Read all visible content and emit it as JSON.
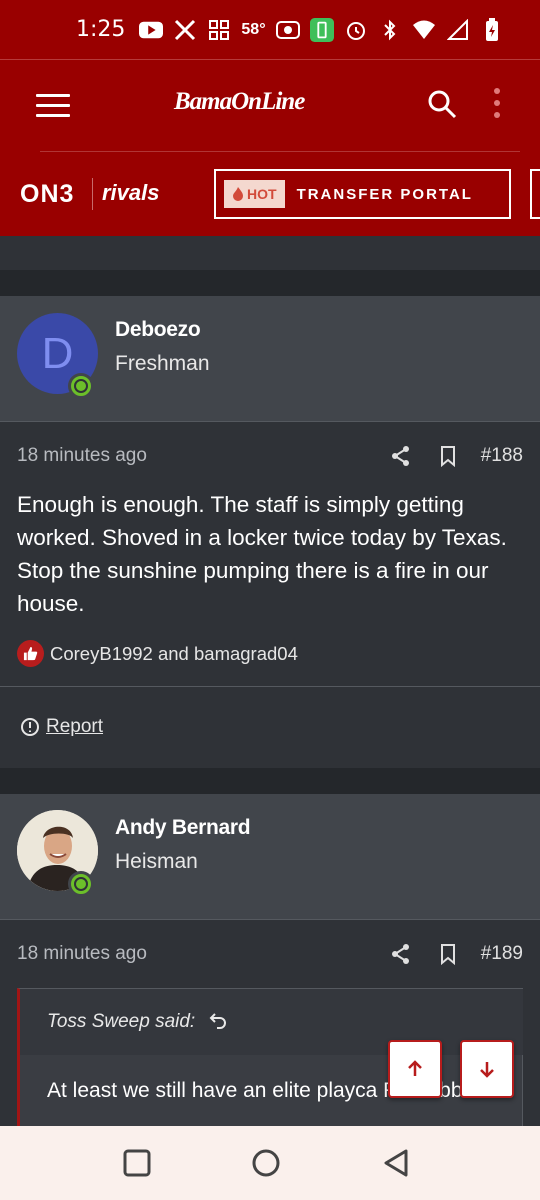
{
  "status_bar": {
    "time": "1:25",
    "temperature": "58°"
  },
  "header": {
    "logo": "BamaOnLine"
  },
  "brand_strip": {
    "on3_label": "ON3",
    "rivals_label": "rivals",
    "hot_label": "HOT",
    "transfer_portal_label": "TRANSFER PORTAL"
  },
  "previous_post": {
    "report_label": "Report"
  },
  "posts": [
    {
      "avatar_letter": "D",
      "username": "Deboezo",
      "rank": "Freshman",
      "time_ago": "18 minutes ago",
      "post_number": "#188",
      "body": "Enough is enough. The staff is simply getting worked. Shoved in a locker twice today by Texas. Stop the sunshine pumping there is a fire in our house.",
      "likes_text": "CoreyB1992 and bamagrad04",
      "report_label": "Report"
    },
    {
      "username": "Andy Bernard",
      "rank": "Heisman",
      "time_ago": "18 minutes ago",
      "post_number": "#189",
      "quote_author": "Toss Sweep said:",
      "quote_text": "At least we still have an elite playca R Grubb"
    }
  ],
  "colors": {
    "brand_red": "#990000",
    "content_bg": "#2f3237",
    "online_green": "#6cbf2a"
  }
}
